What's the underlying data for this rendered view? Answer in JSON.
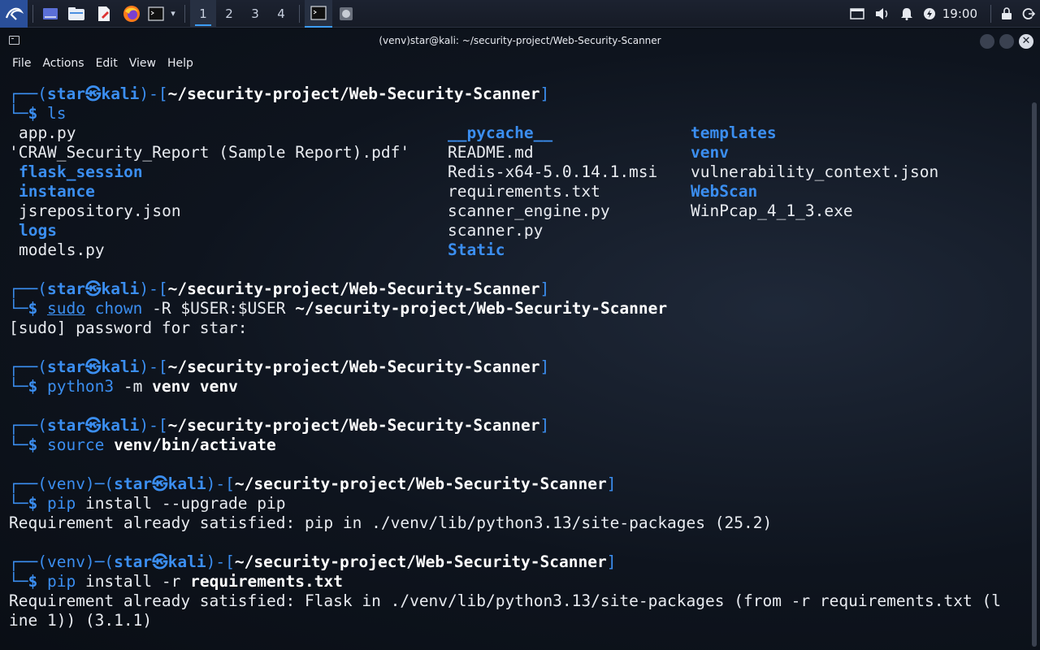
{
  "taskbar": {
    "icons": [
      "kali-menu-icon",
      "desktop-icon",
      "file-manager-icon",
      "text-editor-icon",
      "firefox-icon",
      "terminal-icon",
      "chevron-down-icon"
    ],
    "workspaces": [
      "1",
      "2",
      "3",
      "4"
    ],
    "active_workspace": "1",
    "clock": "19:00"
  },
  "window": {
    "title": "(venv)star@kali: ~/security-project/Web-Security-Scanner",
    "close_glyph": "✕"
  },
  "menu": [
    "File",
    "Actions",
    "Edit",
    "View",
    "Help"
  ],
  "terminal": {
    "user": "star",
    "host": "kali",
    "at": "㉿",
    "cwd": "~/security-project/Web-Security-Scanner",
    "venv": "(venv)",
    "ls_cmd": "ls",
    "ls_col1": [
      "app.py",
      "'CRAW_Security_Report (Sample Report).pdf'",
      "flask_session",
      "instance",
      "jsrepository.json",
      "logs",
      "models.py"
    ],
    "ls_col2": [
      "__pycache__",
      "README.md",
      "Redis-x64-5.0.14.1.msi",
      "requirements.txt",
      "scanner_engine.py",
      "scanner.py",
      "Static"
    ],
    "ls_col3": [
      "templates",
      "venv",
      "vulnerability_context.json",
      "WebScan",
      "WinPcap_4_1_3.exe"
    ],
    "cmd2": {
      "sudo": "sudo",
      "chown": "chown",
      "opt": "-R",
      "arg1": "$USER:$USER",
      "arg2": "~/security-project/Web-Security-Scanner"
    },
    "sudo_prompt": "[sudo] password for star:",
    "cmd3": {
      "prog": "python3",
      "opt": "-m",
      "arg1": "venv",
      "arg2": "venv"
    },
    "cmd4": {
      "prog": "source",
      "arg": "venv/bin/activate"
    },
    "cmd5": {
      "prog": "pip",
      "rest": "install --upgrade pip"
    },
    "out5": "Requirement already satisfied: pip in ./venv/lib/python3.13/site-packages (25.2)",
    "cmd6": {
      "prog": "pip",
      "rest": "install -r",
      "arg": "requirements.txt"
    },
    "out6a": "Requirement already satisfied: Flask in ./venv/lib/python3.13/site-packages (from -r requirements.txt (l",
    "out6b": "ine 1)) (3.1.1)"
  },
  "colors": {
    "accent": "#3b8ef0",
    "text": "#e8ebf0",
    "background": "#0e131c"
  }
}
